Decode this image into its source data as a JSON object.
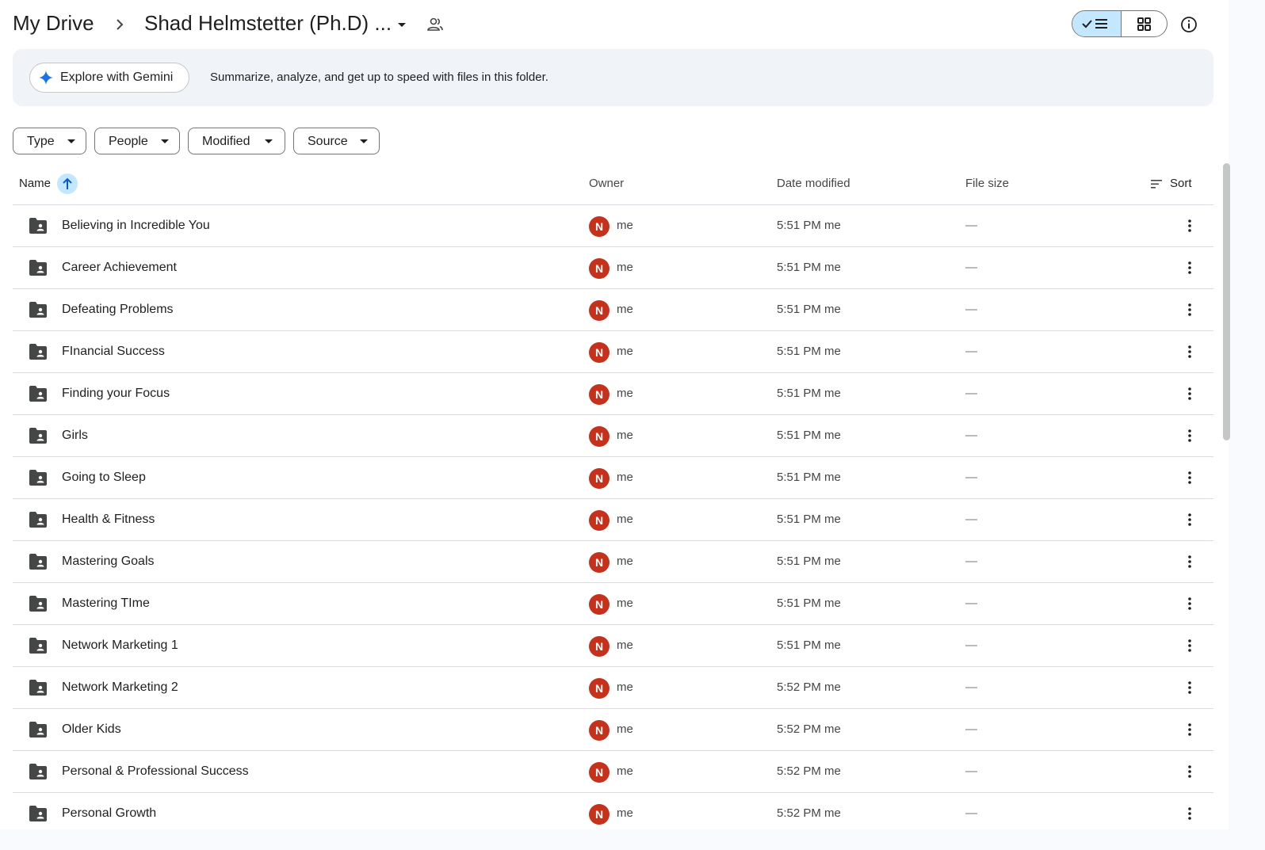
{
  "header": {
    "root_label": "My Drive",
    "current_folder": "Shad Helmstetter (Ph.D) ...",
    "icons": {
      "separator": "chevron-right-icon",
      "folder_menu": "caret-down-icon",
      "share": "people-icon",
      "list_view": "checked-list-view-icon",
      "grid_view": "grid-view-icon",
      "info": "info-icon"
    }
  },
  "gemini": {
    "button_label": "Explore with Gemini",
    "description": "Summarize, analyze, and get up to speed with files in this folder."
  },
  "filters": {
    "type": "Type",
    "people": "People",
    "modified": "Modified",
    "source": "Source"
  },
  "table": {
    "columns": {
      "name": "Name",
      "owner": "Owner",
      "date": "Date modified",
      "size": "File size",
      "sort": "Sort"
    },
    "rows": [
      {
        "name": "Believing in Incredible You",
        "avatar": "N",
        "owner": "me",
        "date": "5:51 PM me",
        "size": "—"
      },
      {
        "name": "Career Achievement",
        "avatar": "N",
        "owner": "me",
        "date": "5:51 PM me",
        "size": "—"
      },
      {
        "name": "Defeating Problems",
        "avatar": "N",
        "owner": "me",
        "date": "5:51 PM me",
        "size": "—"
      },
      {
        "name": "FInancial Success",
        "avatar": "N",
        "owner": "me",
        "date": "5:51 PM me",
        "size": "—"
      },
      {
        "name": "Finding your Focus",
        "avatar": "N",
        "owner": "me",
        "date": "5:51 PM me",
        "size": "—"
      },
      {
        "name": "Girls",
        "avatar": "N",
        "owner": "me",
        "date": "5:51 PM me",
        "size": "—"
      },
      {
        "name": "Going to Sleep",
        "avatar": "N",
        "owner": "me",
        "date": "5:51 PM me",
        "size": "—"
      },
      {
        "name": "Health & Fitness",
        "avatar": "N",
        "owner": "me",
        "date": "5:51 PM me",
        "size": "—"
      },
      {
        "name": "Mastering Goals",
        "avatar": "N",
        "owner": "me",
        "date": "5:51 PM me",
        "size": "—"
      },
      {
        "name": "Mastering TIme",
        "avatar": "N",
        "owner": "me",
        "date": "5:51 PM me",
        "size": "—"
      },
      {
        "name": "Network Marketing 1",
        "avatar": "N",
        "owner": "me",
        "date": "5:51 PM me",
        "size": "—"
      },
      {
        "name": "Network Marketing 2",
        "avatar": "N",
        "owner": "me",
        "date": "5:52 PM me",
        "size": "—"
      },
      {
        "name": "Older Kids",
        "avatar": "N",
        "owner": "me",
        "date": "5:52 PM me",
        "size": "—"
      },
      {
        "name": "Personal & Professional Success",
        "avatar": "N",
        "owner": "me",
        "date": "5:52 PM me",
        "size": "—"
      },
      {
        "name": "Personal Growth",
        "avatar": "N",
        "owner": "me",
        "date": "5:52 PM me",
        "size": "—"
      }
    ]
  },
  "colors": {
    "accent": "#c2e7ff",
    "avatar": "#c5311a",
    "banner": "#f0f4f9",
    "gemini_star": "#1a73e8"
  }
}
